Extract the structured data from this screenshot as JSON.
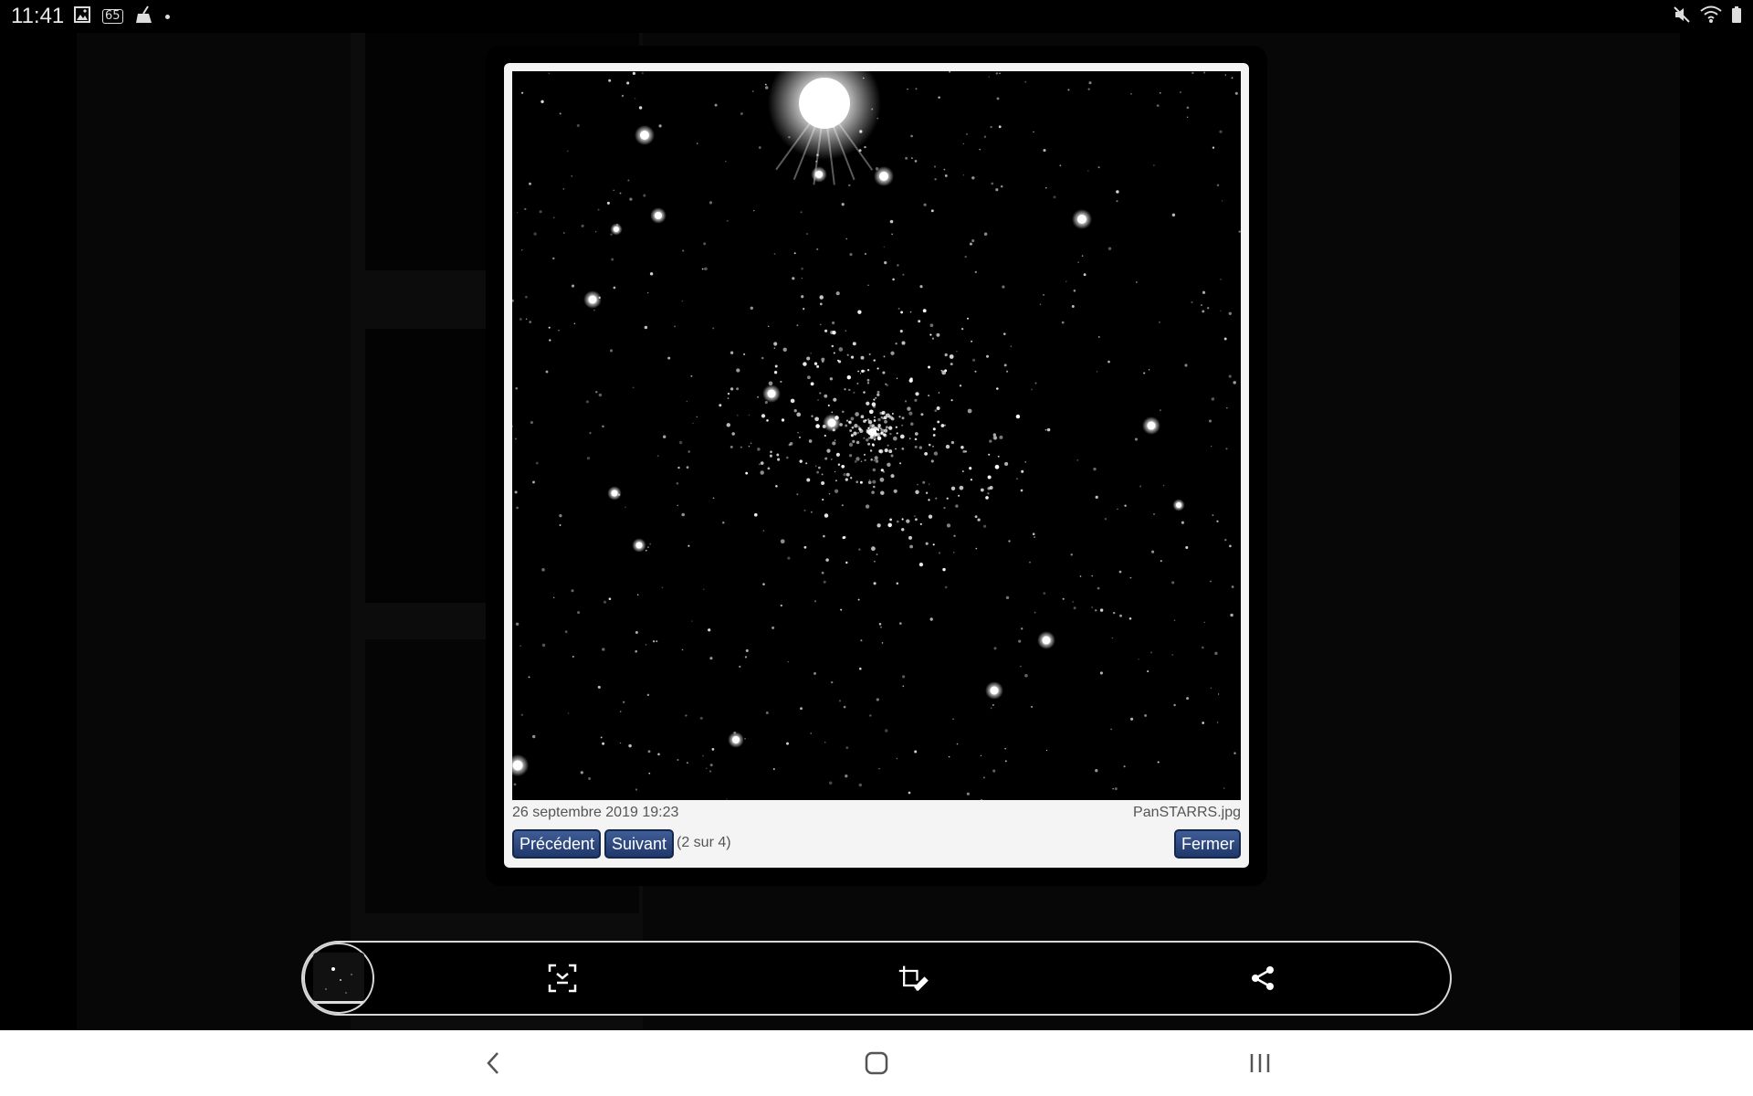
{
  "status_bar": {
    "time": "11:41",
    "badge": "65",
    "left_icons": [
      "gallery-icon",
      "badge-icon",
      "cleaner-icon",
      "dot-icon"
    ],
    "right_icons": [
      "mute-icon",
      "wifi-icon",
      "battery-icon"
    ]
  },
  "lightbox": {
    "date": "26 septembre 2019 19:23",
    "filename": "PanSTARRS.jpg",
    "prev_label": "Précédent",
    "next_label": "Suivant",
    "counter": "(2 sur 4)",
    "close_label": "Fermer"
  },
  "toolbar": {
    "icons": [
      "thumbnail",
      "fit-screen-icon",
      "crop-edit-icon",
      "share-icon"
    ]
  },
  "navbar": {
    "icons": [
      "back-icon",
      "home-icon",
      "recent-apps-icon"
    ]
  },
  "colors": {
    "button_top": "#3f5d96",
    "button_bottom": "#20386a",
    "lightbox_bg": "#f4f4f4",
    "caption_text": "#555555"
  }
}
